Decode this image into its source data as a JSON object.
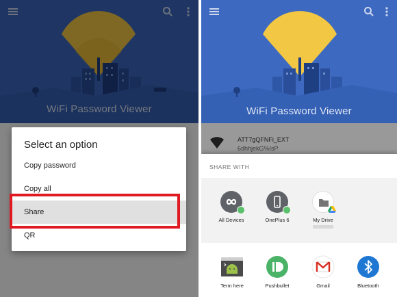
{
  "left_panel": {
    "app_title": "WiFi Password Viewer",
    "dialog": {
      "title": "Select an option",
      "options": [
        "Copy password",
        "Copy all",
        "Share",
        "QR"
      ],
      "selected": "Share"
    }
  },
  "right_panel": {
    "app_title": "WiFi Password Viewer",
    "network": {
      "ssid": "ATT7gQFNFi_EXT",
      "password": "6dhhjekG%IsP"
    },
    "share_sheet": {
      "header": "SHARE WITH",
      "direct_targets": [
        {
          "label": "All Devices",
          "icon": "infinity-icon"
        },
        {
          "label": "OnePlus 6",
          "icon": "phone-icon"
        },
        {
          "label": "My Drive",
          "icon": "folder-icon"
        }
      ],
      "apps": [
        {
          "label": "Term here",
          "icon": "terminal-android-icon"
        },
        {
          "label": "Pushbullet",
          "icon": "pushbullet-icon"
        },
        {
          "label": "Gmail",
          "icon": "gmail-icon"
        },
        {
          "label": "Bluetooth",
          "icon": "bluetooth-icon"
        }
      ]
    }
  },
  "colors": {
    "hero_blue": "#3d69c0",
    "highlight_red": "#e01a22",
    "pushbullet_green": "#4ab367",
    "bluetooth_blue": "#1e77d3"
  }
}
